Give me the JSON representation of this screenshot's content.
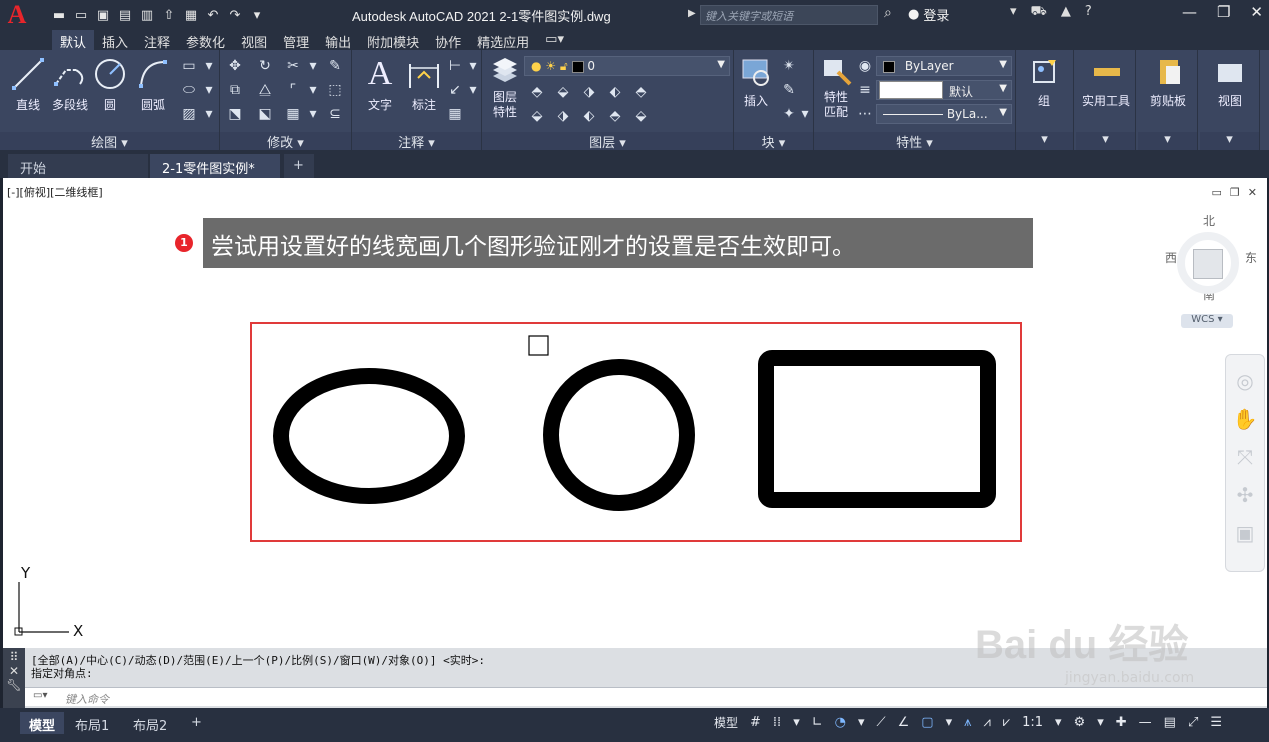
{
  "window": {
    "title": "Autodesk AutoCAD 2021     2-1零件图实例.dwg",
    "search_placeholder": "键入关键字或短语",
    "login_label": "登录"
  },
  "ribbon_tabs": [
    "默认",
    "插入",
    "注释",
    "参数化",
    "视图",
    "管理",
    "输出",
    "附加模块",
    "协作",
    "精选应用"
  ],
  "ribbon": {
    "draw": {
      "title": "绘图",
      "line": "直线",
      "polyline": "多段线",
      "circle": "圆",
      "arc": "圆弧"
    },
    "modify": {
      "title": "修改"
    },
    "annotation": {
      "title": "注释",
      "text": "文字",
      "dimension": "标注"
    },
    "layers": {
      "title": "图层",
      "layer_properties": "图层\n特性",
      "current_layer": "0"
    },
    "block": {
      "title": "块",
      "insert": "插入"
    },
    "properties": {
      "title": "特性",
      "match": "特性\n匹配",
      "color": "ByLayer",
      "lineweight": "默认",
      "linetype": "ByLa..."
    },
    "group": {
      "label": "组"
    },
    "utilities": {
      "label": "实用工具"
    },
    "clipboard": {
      "label": "剪贴板"
    },
    "view": {
      "label": "视图"
    }
  },
  "doc_tabs": {
    "start": "开始",
    "active": "2-1零件图实例*"
  },
  "canvas": {
    "view_label": "[-][俯视][二维线框]",
    "annotation_num": "1",
    "annotation_text": "尝试用设置好的线宽画几个图形验证刚才的设置是否生效即可。",
    "viewcube": {
      "north": "北",
      "south": "南",
      "east": "东",
      "west": "西",
      "wcs": "WCS"
    },
    "ucs": {
      "x": "X",
      "y": "Y"
    }
  },
  "command": {
    "line1": "[全部(A)/中心(C)/动态(D)/范围(E)/上一个(P)/比例(S)/窗口(W)/对象(O)] <实时>:",
    "line2": "指定对角点:",
    "input_placeholder": "键入命令"
  },
  "status": {
    "tabs": [
      "模型",
      "布局1",
      "布局2"
    ],
    "model_label": "模型",
    "scale": "1:1"
  },
  "watermark": {
    "logo": "Bai du 经验",
    "site": "jingyan.baidu.com"
  }
}
